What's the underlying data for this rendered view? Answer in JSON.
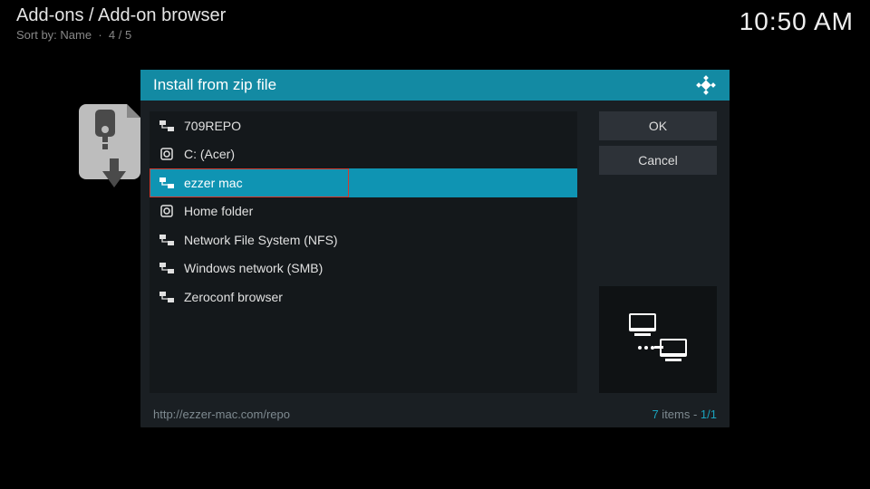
{
  "header": {
    "breadcrumb": "Add-ons / Add-on browser",
    "sort_label": "Sort by: Name",
    "page_indicator": "4 / 5"
  },
  "clock": "10:50 AM",
  "dialog": {
    "title": "Install from zip file",
    "items": [
      {
        "icon": "net",
        "label": "709REPO"
      },
      {
        "icon": "disk",
        "label": "C: (Acer)"
      },
      {
        "icon": "net",
        "label": "ezzer mac",
        "selected": true
      },
      {
        "icon": "disk",
        "label": "Home folder"
      },
      {
        "icon": "net",
        "label": "Network File System (NFS)"
      },
      {
        "icon": "net",
        "label": "Windows network (SMB)"
      },
      {
        "icon": "net",
        "label": "Zeroconf browser"
      }
    ],
    "buttons": {
      "ok": "OK",
      "cancel": "Cancel"
    },
    "status_path": "http://ezzer-mac.com/repo",
    "status_count_num": "7",
    "status_count_word": " items - ",
    "status_page": "1/1"
  }
}
